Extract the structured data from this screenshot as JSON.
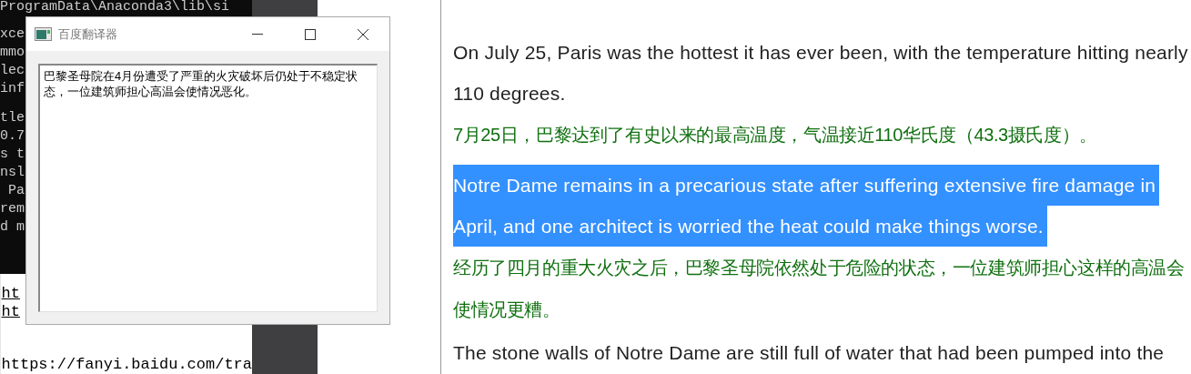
{
  "terminal": {
    "path_line": "ProgramData\\Anaconda3\\lib\\si",
    "line_groups": [
      [
        "xce",
        "mmo",
        "lec",
        "inf"
      ],
      [
        "tle",
        "0.7",
        "s t",
        "nsl",
        " Pa",
        "rem",
        "d m"
      ]
    ]
  },
  "output_pane": {
    "links": [
      "ht",
      "ht"
    ],
    "url": "https://fanyi.baidu.com/tra"
  },
  "dialog": {
    "title": "百度翻译器",
    "text": "巴黎圣母院在4月份遭受了严重的火灾破坏后仍处于不稳定状态，一位建筑师担心高温会使情况恶化。"
  },
  "article": {
    "paragraphs": [
      {
        "kind": "english",
        "selected": false,
        "lines": [
          "On July 25, Paris was the hottest it has ever been, with the temperature hitting nearly",
          "110 degrees."
        ]
      },
      {
        "kind": "chinese",
        "selected": false,
        "lines": [
          "7月25日，巴黎达到了有史以来的最高温度，气温接近110华氏度（43.3摄氏度）。"
        ]
      },
      {
        "kind": "english",
        "selected": true,
        "lines": [
          "Notre Dame remains in a precarious state after suffering extensive fire damage in",
          "April, and one architect is worried the heat could make things worse."
        ]
      },
      {
        "kind": "chinese",
        "selected": false,
        "lines": [
          "经历了四月的重大火灾之后，巴黎圣母院依然处于危险的状态，一位建筑师担心这样的高温会",
          "使情况更糟。"
        ]
      },
      {
        "kind": "english",
        "selected": false,
        "lines": [
          "The stone walls of Notre Dame are still full of water that had been pumped into the"
        ]
      }
    ]
  }
}
